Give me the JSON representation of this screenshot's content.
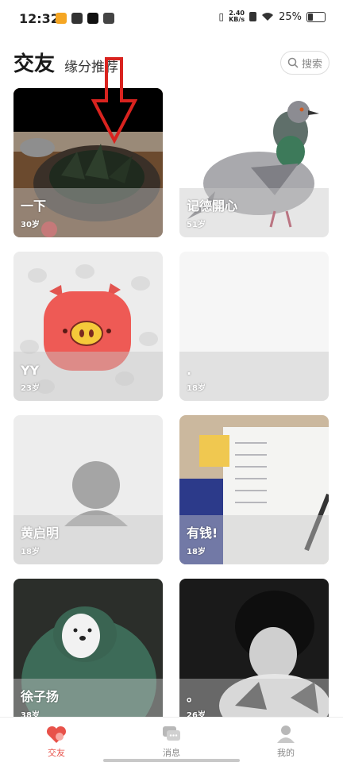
{
  "status_bar": {
    "time": "12:32",
    "net_speed_value": "2.40",
    "net_speed_unit": "KB/s",
    "battery": "25%",
    "battery_level": 0.25
  },
  "header": {
    "title": "交友",
    "subtitle": "缘分推荐",
    "search_label": "搜索"
  },
  "cards": [
    {
      "name": "一下",
      "age": "30岁"
    },
    {
      "name": "记德開心",
      "age": "51岁"
    },
    {
      "name": "YY",
      "age": "23岁"
    },
    {
      "name": ".",
      "age": "18岁"
    },
    {
      "name": "黄启明",
      "age": "18岁"
    },
    {
      "name": "有钱!",
      "age": "18岁"
    },
    {
      "name": "徐子扬",
      "age": "38岁"
    },
    {
      "name": "。",
      "age": "26岁"
    }
  ],
  "nav": {
    "friends": "交友",
    "messages": "消息",
    "me": "我的"
  },
  "colors": {
    "accent": "#e8524a",
    "annotation_arrow": "#d9231f"
  }
}
